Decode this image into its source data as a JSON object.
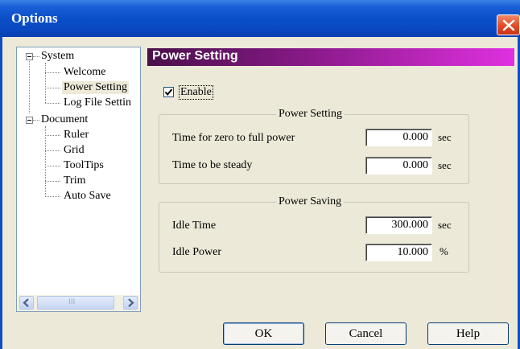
{
  "window": {
    "title": "Options"
  },
  "tree": {
    "system": {
      "label": "System",
      "children": [
        "Welcome",
        "Power Setting",
        "Log File Settin"
      ]
    },
    "document": {
      "label": "Document",
      "children": [
        "Ruler",
        "Grid",
        "ToolTips",
        "Trim",
        "Auto Save"
      ]
    },
    "selected": "Power Setting",
    "scroll_grip": "III"
  },
  "panel": {
    "header": "Power Setting",
    "enable_label": "Enable",
    "enable_checked": true,
    "power_group": {
      "title": "Power Setting",
      "fields": [
        {
          "label": "Time for zero to full power",
          "value": "0.000",
          "unit": "sec"
        },
        {
          "label": "Time to be steady",
          "value": "0.000",
          "unit": "sec"
        }
      ]
    },
    "saving_group": {
      "title": "Power Saving",
      "fields": [
        {
          "label": "Idle Time",
          "value": "300.000",
          "unit": "sec"
        },
        {
          "label": "Idle Power",
          "value": "10.000",
          "unit": "%"
        }
      ]
    }
  },
  "buttons": {
    "ok": "OK",
    "cancel": "Cancel",
    "help": "Help"
  }
}
